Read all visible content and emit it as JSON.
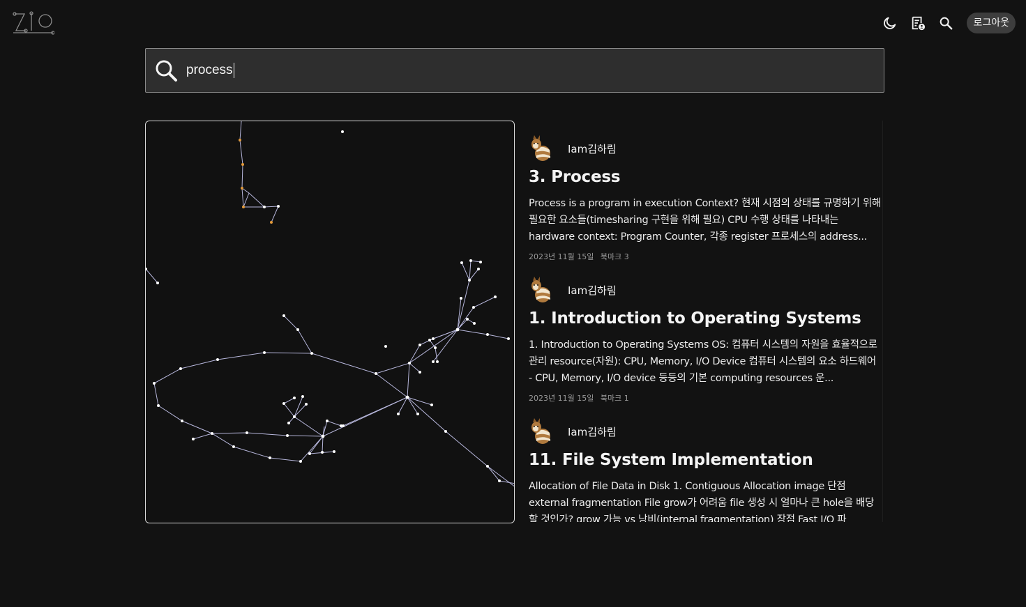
{
  "header": {
    "logo_text": "ZIO",
    "icons": [
      "moon-icon",
      "notes-icon",
      "search-icon"
    ],
    "logout_label": "로그아웃"
  },
  "search": {
    "value": "process"
  },
  "results": [
    {
      "author": "Iam김하림",
      "title": "3. Process",
      "body": "Process is a program in execution Context? 현재 시점의 상태를 규명하기 위해 필요한 요소들(timesharing 구현을 위해 필요) CPU 수행 상태를 나타내는 hardware context: Program Counter, 각종 register 프로세스의 address...",
      "date": "2023년 11월 15일",
      "bookmarks": "북마크 3"
    },
    {
      "author": "Iam김하림",
      "title": "1. Introduction to Operating Systems",
      "body": "1. Introduction to Operating Systems OS: 컴퓨터 시스템의 자원을 효율적으로 관리 resource(자원): CPU, Memory, I/O Device 컴퓨터 시스템의 요소 하드웨어 - CPU, Memory, I/O device 등등의 기본 computing resources 운...",
      "date": "2023년 11월 15일",
      "bookmarks": "북마크 1"
    },
    {
      "author": "Iam김하림",
      "title": "11. File System Implementation",
      "body": "Allocation of File Data in Disk 1. Contiguous Allocation image 단점 external fragmentation File grow가 어려움 file 생성 시 얼마나 큰 hole을 배당할 것인가? grow 가능 vs 낭비(internal fragmentation) 장점 Fast I/O 파",
      "date": "",
      "bookmarks": ""
    }
  ],
  "colors": {
    "background": "#121212",
    "graph_edge": "#c9c9f2",
    "graph_node": "#ffffff",
    "graph_highlight": "#e39a3a"
  }
}
